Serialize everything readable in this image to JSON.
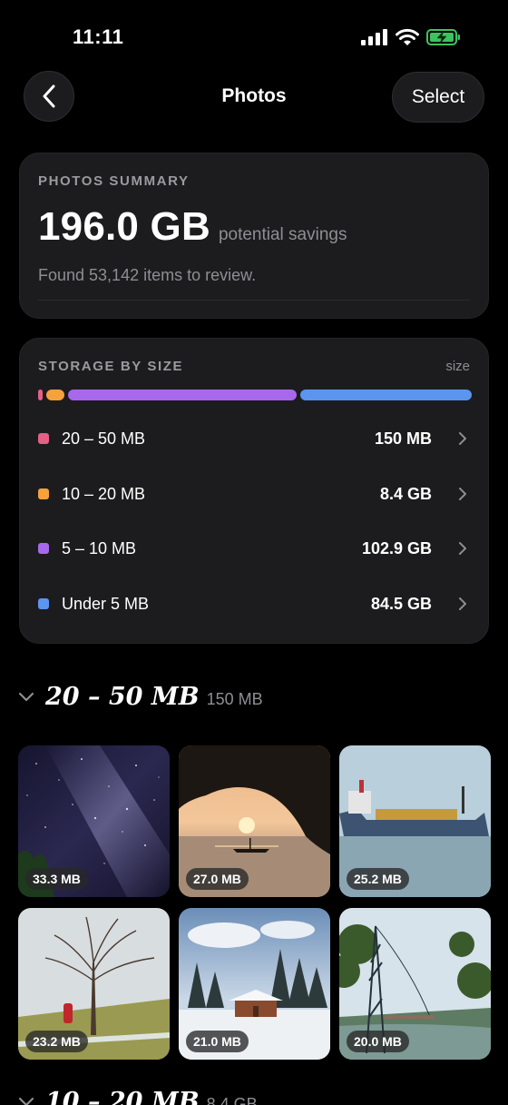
{
  "status_bar": {
    "time": "11:11"
  },
  "nav": {
    "title": "Photos",
    "select_label": "Select"
  },
  "summary": {
    "label": "PHOTOS SUMMARY",
    "amount": "196.0 GB",
    "amount_suffix": "potential savings",
    "found": "Found 53,142 items to review."
  },
  "storage": {
    "label": "STORAGE BY SIZE",
    "sort_label": "size",
    "rows": [
      {
        "name": "20 – 50 MB",
        "value": "150 MB",
        "color": "#e65f86"
      },
      {
        "name": "10 – 20 MB",
        "value": "8.4 GB",
        "color": "#f5a23d"
      },
      {
        "name": "5 – 10 MB",
        "value": "102.9 GB",
        "color": "#a868ec"
      },
      {
        "name": "Under 5 MB",
        "value": "84.5 GB",
        "color": "#5b95ee"
      }
    ]
  },
  "groups": [
    {
      "title": "20 – 50 MB",
      "size": "150 MB",
      "photos": [
        {
          "size": "33.3 MB",
          "scene": "milky-way"
        },
        {
          "size": "27.0 MB",
          "scene": "sunset-boat"
        },
        {
          "size": "25.2 MB",
          "scene": "cargo-ship"
        },
        {
          "size": "23.2 MB",
          "scene": "winter-tree"
        },
        {
          "size": "21.0 MB",
          "scene": "snow-cabin"
        },
        {
          "size": "20.0 MB",
          "scene": "bridge-lake"
        }
      ]
    },
    {
      "title": "10 – 20 MB",
      "size": "8.4 GB"
    }
  ]
}
